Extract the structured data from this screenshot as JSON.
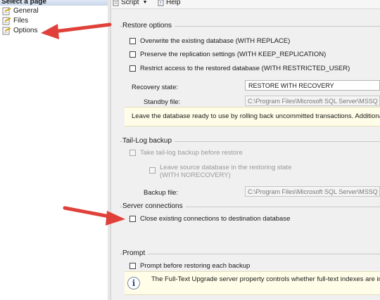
{
  "left_pane": {
    "header": "Select a page",
    "items": [
      {
        "label": "General",
        "icon": "page-icon"
      },
      {
        "label": "Files",
        "icon": "page-icon"
      },
      {
        "label": "Options",
        "icon": "page-icon"
      }
    ]
  },
  "toolbar": {
    "script_label": "Script",
    "help_label": "Help"
  },
  "restore_options": {
    "title": "Restore options",
    "overwrite": "Overwrite the existing database (WITH REPLACE)",
    "keep_replication": "Preserve the replication settings (WITH KEEP_REPLICATION)",
    "restricted_user": "Restrict access to the restored database (WITH RESTRICTED_USER)",
    "recovery_state_label": "Recovery state:",
    "recovery_state_value": "RESTORE WITH RECOVERY",
    "standby_label": "Standby file:",
    "standby_value": "C:\\Program Files\\Microsoft SQL Server\\MSSQ",
    "info_text": "Leave the database ready to use by rolling back uncommitted transactions. Additiona"
  },
  "tail_log": {
    "title": "Tail-Log backup",
    "take_backup": "Take tail-log backup before restore",
    "leave_source_line1": "Leave source database in the restoring state",
    "leave_source_line2": "(WITH NORECOVERY)",
    "backup_file_label": "Backup file:",
    "backup_file_value": "C:\\Program Files\\Microsoft SQL Server\\MSSQ"
  },
  "server_connections": {
    "title": "Server connections",
    "close_existing": "Close existing connections to destination database"
  },
  "prompt": {
    "title": "Prompt",
    "prompt_before": "Prompt before restoring each backup",
    "info_text": "The Full-Text Upgrade server property controls whether full-text indexes are im"
  },
  "colors": {
    "annotation_arrow": "#e0403a",
    "info_background": "#fffde7"
  }
}
